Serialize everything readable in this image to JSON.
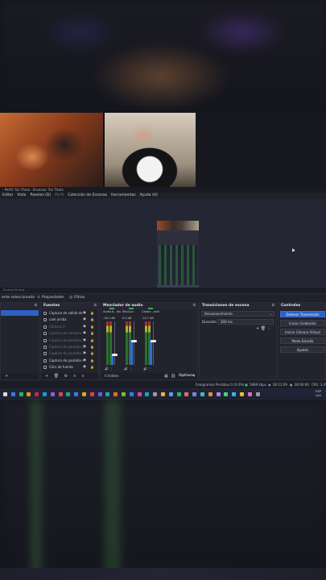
{
  "window": {
    "title": "- Perfil: Sin Título - Escenas: Sin Título",
    "menu": [
      "Editar",
      "Vista",
      "Paneles (D)",
      "Perfil",
      "Colección de Escenas",
      "Herramientas",
      "Ayuda (H)"
    ]
  },
  "scene_row": {
    "label": "Escena en vivo"
  },
  "props_bar": {
    "no_source": "ente seleccionada",
    "properties": "Propiedades",
    "filters": "Filtros"
  },
  "docks": {
    "sources": {
      "title": "Fuentes",
      "items": [
        {
          "name": "Captura de salida de",
          "dim": false
        },
        {
          "name": "cam arriba",
          "dim": false
        },
        {
          "name": "Cámara 2",
          "dim": true
        },
        {
          "name": "Captura de ventana",
          "dim": true
        },
        {
          "name": "Captura de pantalla",
          "dim": true
        },
        {
          "name": "Captura de pantalla 2",
          "dim": true
        },
        {
          "name": "Captura de pantalla 3",
          "dim": true
        },
        {
          "name": "Captura de pantalla 4",
          "dim": false
        },
        {
          "name": "Clics de fuente",
          "dim": false
        }
      ]
    },
    "mixer": {
      "title": "Mezclador de audio",
      "channels": [
        {
          "label": "Audio d...ritorio",
          "db": "-18.1 dB",
          "level": 0.25
        },
        {
          "label": "Mic/Aux",
          "db": "0.0 dB",
          "level": 0.55
        },
        {
          "label": "Captur...salida 2",
          "db": "-10.7 dB",
          "level": 0.55
        }
      ],
      "hidden": "6 hidden",
      "options": "Options"
    },
    "transitions": {
      "title": "Transiciones de escena",
      "type": "Desvanecimiento",
      "duration_label": "Duración",
      "duration_value": "200 ms"
    },
    "controls": {
      "title": "Controles",
      "buttons": [
        "Detener Transmisión",
        "Iniciar Grabación",
        "Iniciar Cámara Virtual",
        "Modo Estudio",
        "Ajustes"
      ]
    }
  },
  "status": {
    "dropped": "Fotogramas Perdidos 0 (0.0%)",
    "kbps": "5889 kbps",
    "live_time": "00:12:09",
    "rec_time": "00:00:00",
    "cpu": "CPU: 3.4%"
  },
  "taskbar": {
    "lang": "ESP",
    "lang2": "LAA"
  },
  "colors": {
    "accent": "#2d61c4",
    "panel": "#22232d",
    "meter_green": "#2e7d32"
  }
}
